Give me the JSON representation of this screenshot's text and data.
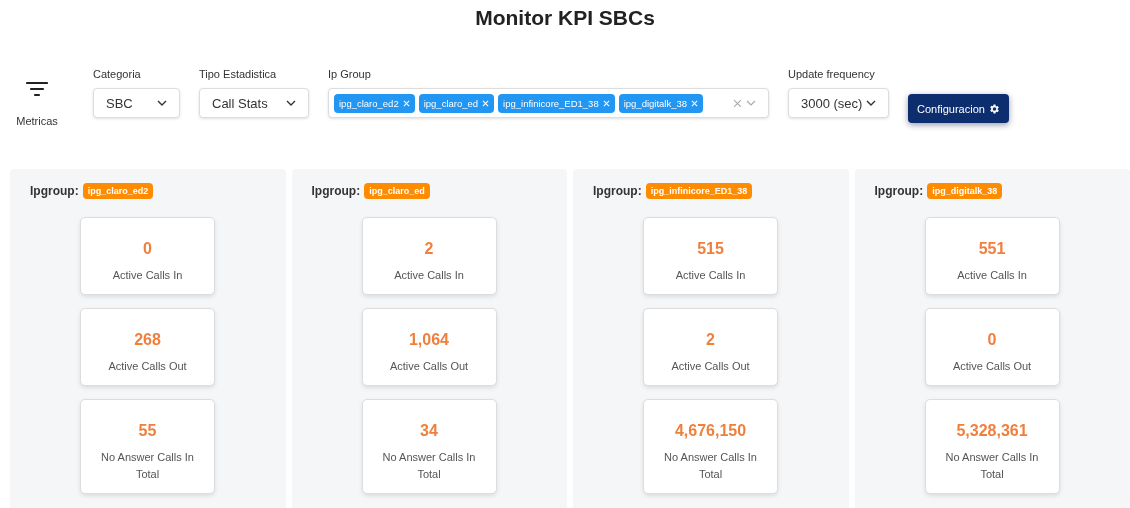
{
  "title": "Monitor KPI SBCs",
  "filters": {
    "metrics_label": "Metricas",
    "categoria": {
      "label": "Categoria",
      "value": "SBC"
    },
    "tipo": {
      "label": "Tipo Estadistica",
      "value": "Call Stats"
    },
    "ip_group": {
      "label": "Ip Group",
      "tags": [
        "ipg_claro_ed2",
        "ipg_claro_ed",
        "ipg_infinicore_ED1_38",
        "ipg_digitalk_38"
      ]
    },
    "frequency": {
      "label": "Update frequency",
      "value": "3000 (sec)"
    },
    "config_button": "Configuracion"
  },
  "panels": [
    {
      "label": "Ipgroup:",
      "group": "ipg_claro_ed2",
      "metrics": [
        {
          "value": "0",
          "label": "Active Calls In"
        },
        {
          "value": "268",
          "label": "Active Calls Out"
        },
        {
          "value": "55",
          "label": "No Answer Calls In Total"
        }
      ]
    },
    {
      "label": "Ipgroup:",
      "group": "ipg_claro_ed",
      "metrics": [
        {
          "value": "2",
          "label": "Active Calls In"
        },
        {
          "value": "1,064",
          "label": "Active Calls Out"
        },
        {
          "value": "34",
          "label": "No Answer Calls In Total"
        }
      ]
    },
    {
      "label": "Ipgroup:",
      "group": "ipg_infinicore_ED1_38",
      "metrics": [
        {
          "value": "515",
          "label": "Active Calls In"
        },
        {
          "value": "2",
          "label": "Active Calls Out"
        },
        {
          "value": "4,676,150",
          "label": "No Answer Calls In Total"
        }
      ]
    },
    {
      "label": "Ipgroup:",
      "group": "ipg_digitalk_38",
      "metrics": [
        {
          "value": "551",
          "label": "Active Calls In"
        },
        {
          "value": "0",
          "label": "Active Calls Out"
        },
        {
          "value": "5,328,361",
          "label": "No Answer Calls In Total"
        }
      ]
    }
  ]
}
